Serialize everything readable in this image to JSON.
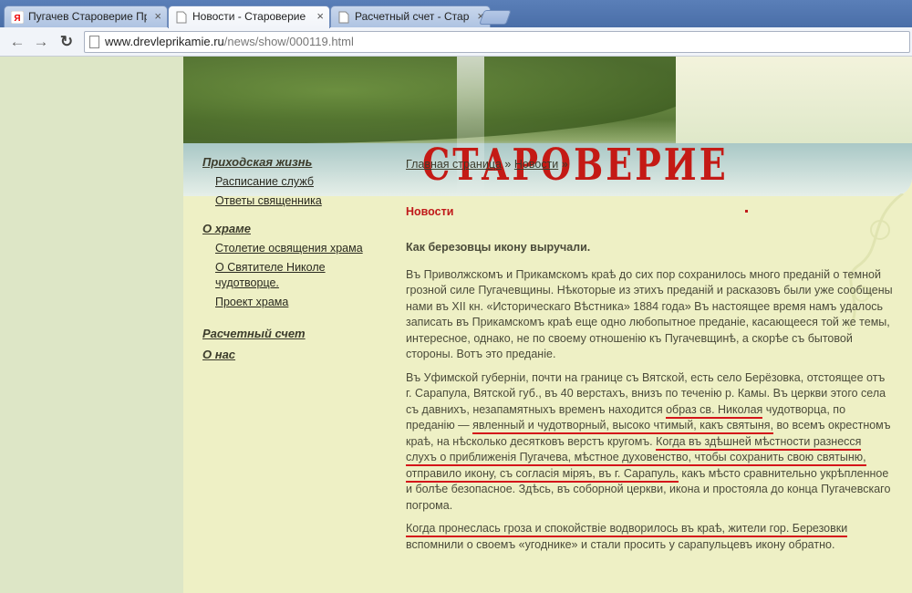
{
  "browser": {
    "tabs": [
      {
        "title": "Пугачев Староверие Прик",
        "active": false
      },
      {
        "title": "Новости - Староверие Пр",
        "active": true
      },
      {
        "title": "Расчетный счет - Старов",
        "active": false
      }
    ],
    "close_glyph": "×",
    "url_domain": "www.drevleprikamie.ru",
    "url_path": "/news/show/000119.html"
  },
  "banner": {
    "site_title": "СТАРОВЕРИЕ ПРИКАМЬЯ"
  },
  "menu": {
    "section1": "Приходская жизнь",
    "s1_items": [
      "Расписание служб",
      "Ответы священника"
    ],
    "section2": "О храме",
    "s2_items": [
      "Столетие освящения храма",
      "О Святителе Николе чудотворце.",
      "Проект храма"
    ],
    "section3": "Расчетный счет",
    "section4": "О нас"
  },
  "breadcrumb": {
    "home": "Главная страница",
    "sep": "»",
    "news": "Новости",
    "trail": "»"
  },
  "article": {
    "section_title": "Новости",
    "headline": "Как березовцы икону выручали.",
    "p1": "Въ Приволжскомъ и Прикамскомъ краѣ до сих пор сохранилось много преданій о темной грозной силе Пугачевщины. Нѣкоторые из этихъ преданій и расказовъ были уже сообщены нами въ XII кн. «Историческаго Вѣстника» 1884 года» Въ настоящее время намъ удалось записать въ Прикамскомъ краѣ еще одно любопытное преданіе, касающееся той же темы, интересное, однако, не по своему отношенію къ Пугачевщинѣ, а скорѣе съ бытовой стороны. Вотъ это преданіе.",
    "p2a": "Въ Уфимской губерніи, почти на границе съ Вятской, есть село Берёзовка, отстоящее отъ г. Сарапула, Вятской губ., въ 40 верстахъ, внизъ по теченію р. Камы. Въ церкви этого села съ давнихъ, незапамятныхъ временъ находится ",
    "p2u1": "образ св. Николая",
    "p2b": " чудотворца, по преданію — ",
    "p2u2": "явленный и чудотворный, высоко чтимый, какъ святыня,",
    "p2c": " во всемъ окрестномъ краѣ, на нѣсколько десятковъ верстъ кругомъ. ",
    "p2u3": "Когда въ здѣшней мѣстности разнесся слухъ о приближенія Пугачева, мѣстное духовенство, чтобы сохранить свою святыню, отправило икону, съ согласія міряъ, въ г. Сарапуль,",
    "p2d": " какъ мѣсто сравнительно укрѣпленное и болѣе безопасное. Здѣсь, въ соборной церкви, икона и простояла до конца Пугачевскаго погрома.",
    "p3u": "Когда пронеслась гроза и спокойствіе водворилось въ краѣ, жители гор. Березовки",
    "p3b": " вспомнили о своемъ «угоднике» и стали просить у сарапульцевъ икону обратно."
  }
}
